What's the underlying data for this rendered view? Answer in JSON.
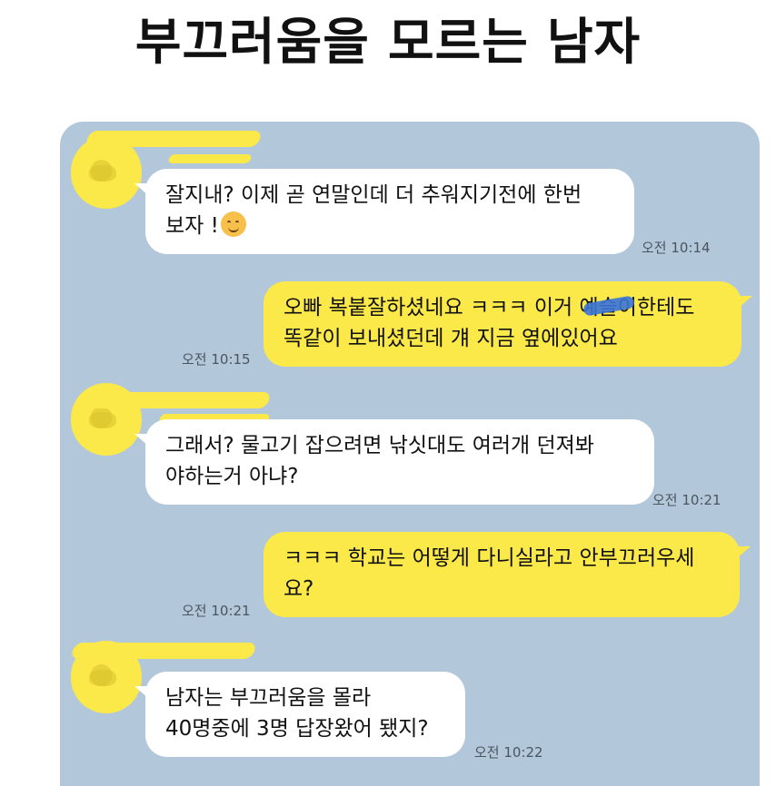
{
  "title": "부끄러움을 모르는 남자",
  "colors": {
    "chat_bg": "#b2c7d9",
    "bubble_out": "#fbe94a",
    "bubble_in": "#ffffff"
  },
  "messages": [
    {
      "side": "in",
      "text": "잘지내? 이제 곧 연말인데 더 추워지기전에 한번\n보자 !",
      "emoji": "hugging-face-icon",
      "time": "오전 10:14"
    },
    {
      "side": "out",
      "text": "오빠 복붙잘하셨네요 ㅋㅋㅋ 이거 예슬이한테도\n똑같이 보내셨던데 걔 지금 옆에있어요",
      "time": "오전 10:15"
    },
    {
      "side": "in",
      "text": "그래서? 물고기 잡으려면 낚싯대도 여러개 던져봐\n야하는거 아냐?",
      "time": "오전 10:21"
    },
    {
      "side": "out",
      "text": "ㅋㅋㅋ 학교는 어떻게 다니실라고 안부끄러우세\n요?",
      "time": "오전 10:21"
    },
    {
      "side": "in",
      "text": "남자는 부끄러움을 몰라\n40명중에 3명 답장왔어 됐지?",
      "time": "오전 10:22"
    }
  ]
}
